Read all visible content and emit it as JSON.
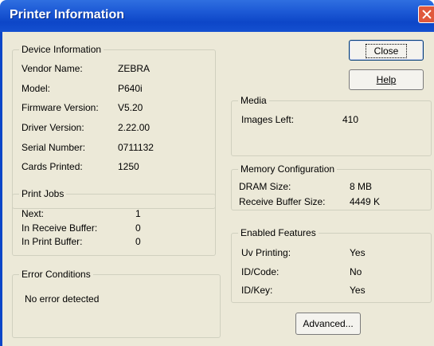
{
  "window": {
    "title": "Printer Information"
  },
  "device_info": {
    "title": "Device Information",
    "rows": [
      {
        "label": "Vendor Name:",
        "value": "ZEBRA"
      },
      {
        "label": "Model:",
        "value": "P640i"
      },
      {
        "label": "Firmware Version:",
        "value": "V5.20"
      },
      {
        "label": "Driver Version:",
        "value": "2.22.00"
      },
      {
        "label": "Serial Number:",
        "value": "0711132"
      },
      {
        "label": "Cards Printed:",
        "value": "1250"
      }
    ]
  },
  "print_jobs": {
    "title": "Print Jobs",
    "rows": [
      {
        "label": "Next:",
        "value": "1"
      },
      {
        "label": "In Receive Buffer:",
        "value": "0"
      },
      {
        "label": "In Print Buffer:",
        "value": "0"
      }
    ]
  },
  "error_conditions": {
    "title": "Error Conditions",
    "message": "No error detected"
  },
  "media": {
    "title": "Media",
    "rows": [
      {
        "label": "Images Left:",
        "value": "410"
      }
    ]
  },
  "memory": {
    "title": "Memory Configuration",
    "rows": [
      {
        "label": "DRAM Size:",
        "value": "8 MB"
      },
      {
        "label": "Receive Buffer Size:",
        "value": "4449 K"
      }
    ]
  },
  "features": {
    "title": "Enabled Features",
    "rows": [
      {
        "label": "Uv Printing:",
        "value": "Yes"
      },
      {
        "label": "ID/Code:",
        "value": "No"
      },
      {
        "label": "ID/Key:",
        "value": "Yes"
      }
    ]
  },
  "buttons": {
    "close": "Close",
    "help": "Help",
    "advanced": "Advanced..."
  },
  "icons": {
    "close": "close-icon"
  },
  "colors": {
    "titlebar": "#0d46c8",
    "dialog_bg": "#ece9d8",
    "close_button": "#e0583c"
  }
}
